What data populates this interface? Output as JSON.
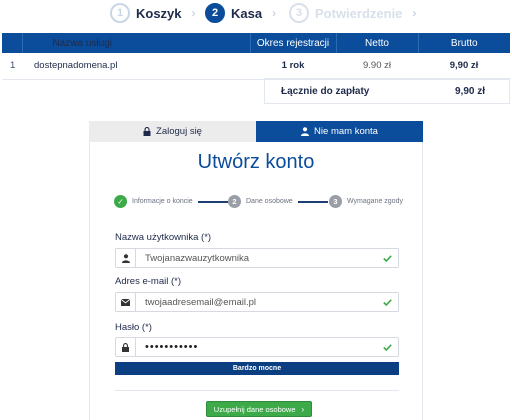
{
  "steps": [
    {
      "number": "1",
      "label": "Koszyk",
      "state": "done"
    },
    {
      "number": "2",
      "label": "Kasa",
      "state": "active"
    },
    {
      "number": "3",
      "label": "Potwierdzenie",
      "state": "todo"
    }
  ],
  "cart": {
    "headers": {
      "service": "Nazwa usługi",
      "period": "Okres rejestracji",
      "net": "Netto",
      "gross": "Brutto"
    },
    "rows": [
      {
        "index": "1",
        "service": "dostepnadomena.pl",
        "period": "1 rok",
        "net": "9.90 zł",
        "gross": "9,90 zł"
      }
    ],
    "total_label": "Łącznie do zapłaty",
    "total_value": "9,90 zł"
  },
  "tabs": {
    "login": "Zaloguj się",
    "no_account": "Nie mam konta"
  },
  "form": {
    "title": "Utwórz konto",
    "wizard": [
      {
        "marker": "✓",
        "label": "Informacje o koncie"
      },
      {
        "marker": "2",
        "label": "Dane osobowe"
      },
      {
        "marker": "3",
        "label": "Wymagane zgody"
      }
    ],
    "username": {
      "label": "Nazwa użytkownika (*)",
      "value": "Twojanazwauzytkownika"
    },
    "email": {
      "label": "Adres e-mail (*)",
      "value": "twojaadresemail@email.pl"
    },
    "password": {
      "label": "Hasło (*)",
      "value": "•••••••••••"
    },
    "strength": "Bardzo mocne",
    "next_button": "Uzupełnij dane osobowe",
    "next_arrow": "›"
  },
  "colors": {
    "primary": "#0b4d9b",
    "success": "#3daa4a"
  },
  "icons": {
    "chevron": "›"
  }
}
